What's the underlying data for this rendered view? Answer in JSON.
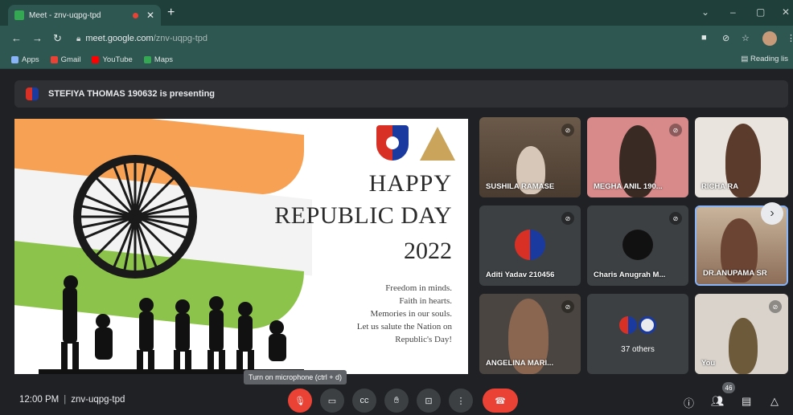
{
  "browser": {
    "tab_title": "Meet - znv-uqpg-tpd",
    "tab_close": "✕",
    "new_tab": "+",
    "window_controls": [
      "⌄",
      "–",
      "▢",
      "✕"
    ],
    "url_host": "meet.google.com",
    "url_path": "/znv-uqpg-tpd",
    "bookmarks": [
      {
        "label": "Apps",
        "color": "#8ab4f8"
      },
      {
        "label": "Gmail",
        "color": "#ea4335"
      },
      {
        "label": "YouTube",
        "color": "#ff0000"
      },
      {
        "label": "Maps",
        "color": "#34a853"
      }
    ],
    "reading_list": "Reading lis"
  },
  "banner": {
    "text": "STEFIYA THOMAS 190632 is presenting"
  },
  "slide": {
    "line1": "HAPPY",
    "line2": "REPUBLIC DAY",
    "line3": "2022",
    "quote": [
      "Freedom in minds.",
      "Faith in hearts.",
      "Memories in our souls.",
      "Let us salute the Nation on",
      "Republic's Day!"
    ],
    "colors": {
      "saffron": "#f7a154",
      "white": "#f3f3f3",
      "green": "#8cc34a",
      "chakra": "#1a3b8f"
    }
  },
  "participants": [
    {
      "name": "SUSHILA RAMASE",
      "muted": true
    },
    {
      "name": "MEGHA ANIL 190...",
      "muted": true
    },
    {
      "name": "RICHA RA",
      "muted": false
    },
    {
      "name": "Aditi Yadav 210456",
      "muted": true
    },
    {
      "name": "Charis Anugrah M...",
      "muted": true
    },
    {
      "name": "DR.ANUPAMA SR",
      "muted": false
    },
    {
      "name": "ANGELINA MARI...",
      "muted": true
    },
    {
      "name": "You",
      "muted": true
    }
  ],
  "others": {
    "label": "37 others"
  },
  "tooltip": "Turn on microphone (ctrl + d)",
  "bottom": {
    "time": "12:00 PM",
    "separator": "|",
    "meeting_code": "znv-uqpg-tpd",
    "people_count": "46"
  },
  "accent": {
    "red": "#ea4335",
    "bar": "#202124"
  }
}
